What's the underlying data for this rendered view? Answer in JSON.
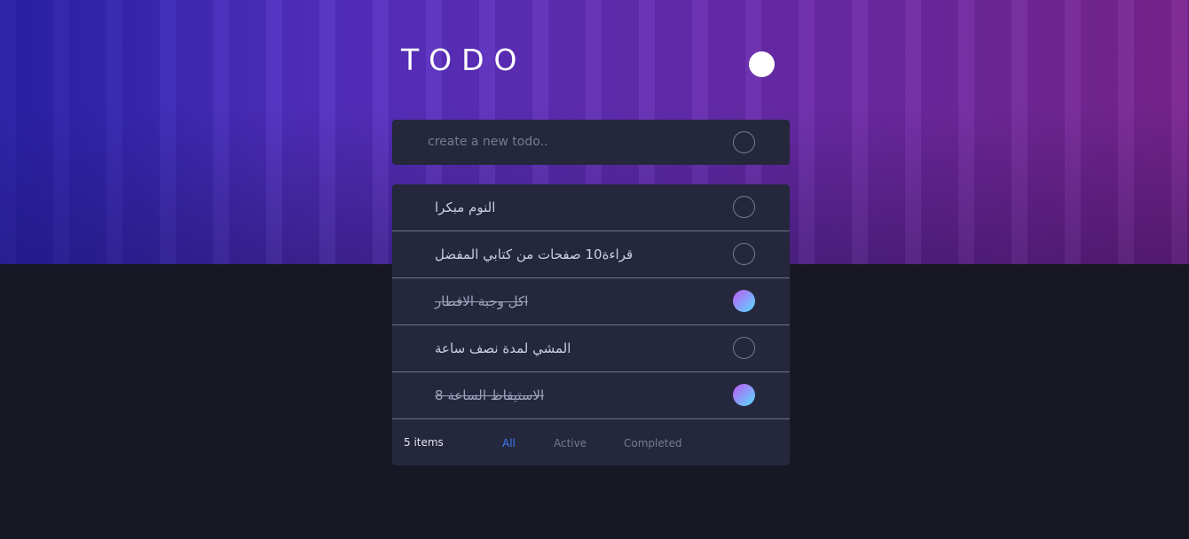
{
  "app": {
    "title": "TODO"
  },
  "new_todo": {
    "placeholder": "create a new todo.."
  },
  "todos": [
    {
      "text": "النوم مبكرا",
      "completed": false
    },
    {
      "text": "قراءة10 صفحات من كتابي المفضل",
      "completed": false
    },
    {
      "text": "اكل وجبة الافطار",
      "completed": true
    },
    {
      "text": "المشي لمدة نصف ساعة",
      "completed": false
    },
    {
      "text": "الاستيقاظ الساعة 8",
      "completed": true
    }
  ],
  "footer": {
    "count": "5 items",
    "filters": {
      "all": "All",
      "active": "Active",
      "completed": "Completed"
    },
    "active_filter": "all"
  },
  "colors": {
    "accent": "#3a7cfd",
    "check_gradient_start": "#c058f3",
    "check_gradient_end": "#55ddff",
    "card": "#25273c",
    "background": "#181824"
  },
  "icons": {
    "theme_toggle": "sun-icon"
  }
}
